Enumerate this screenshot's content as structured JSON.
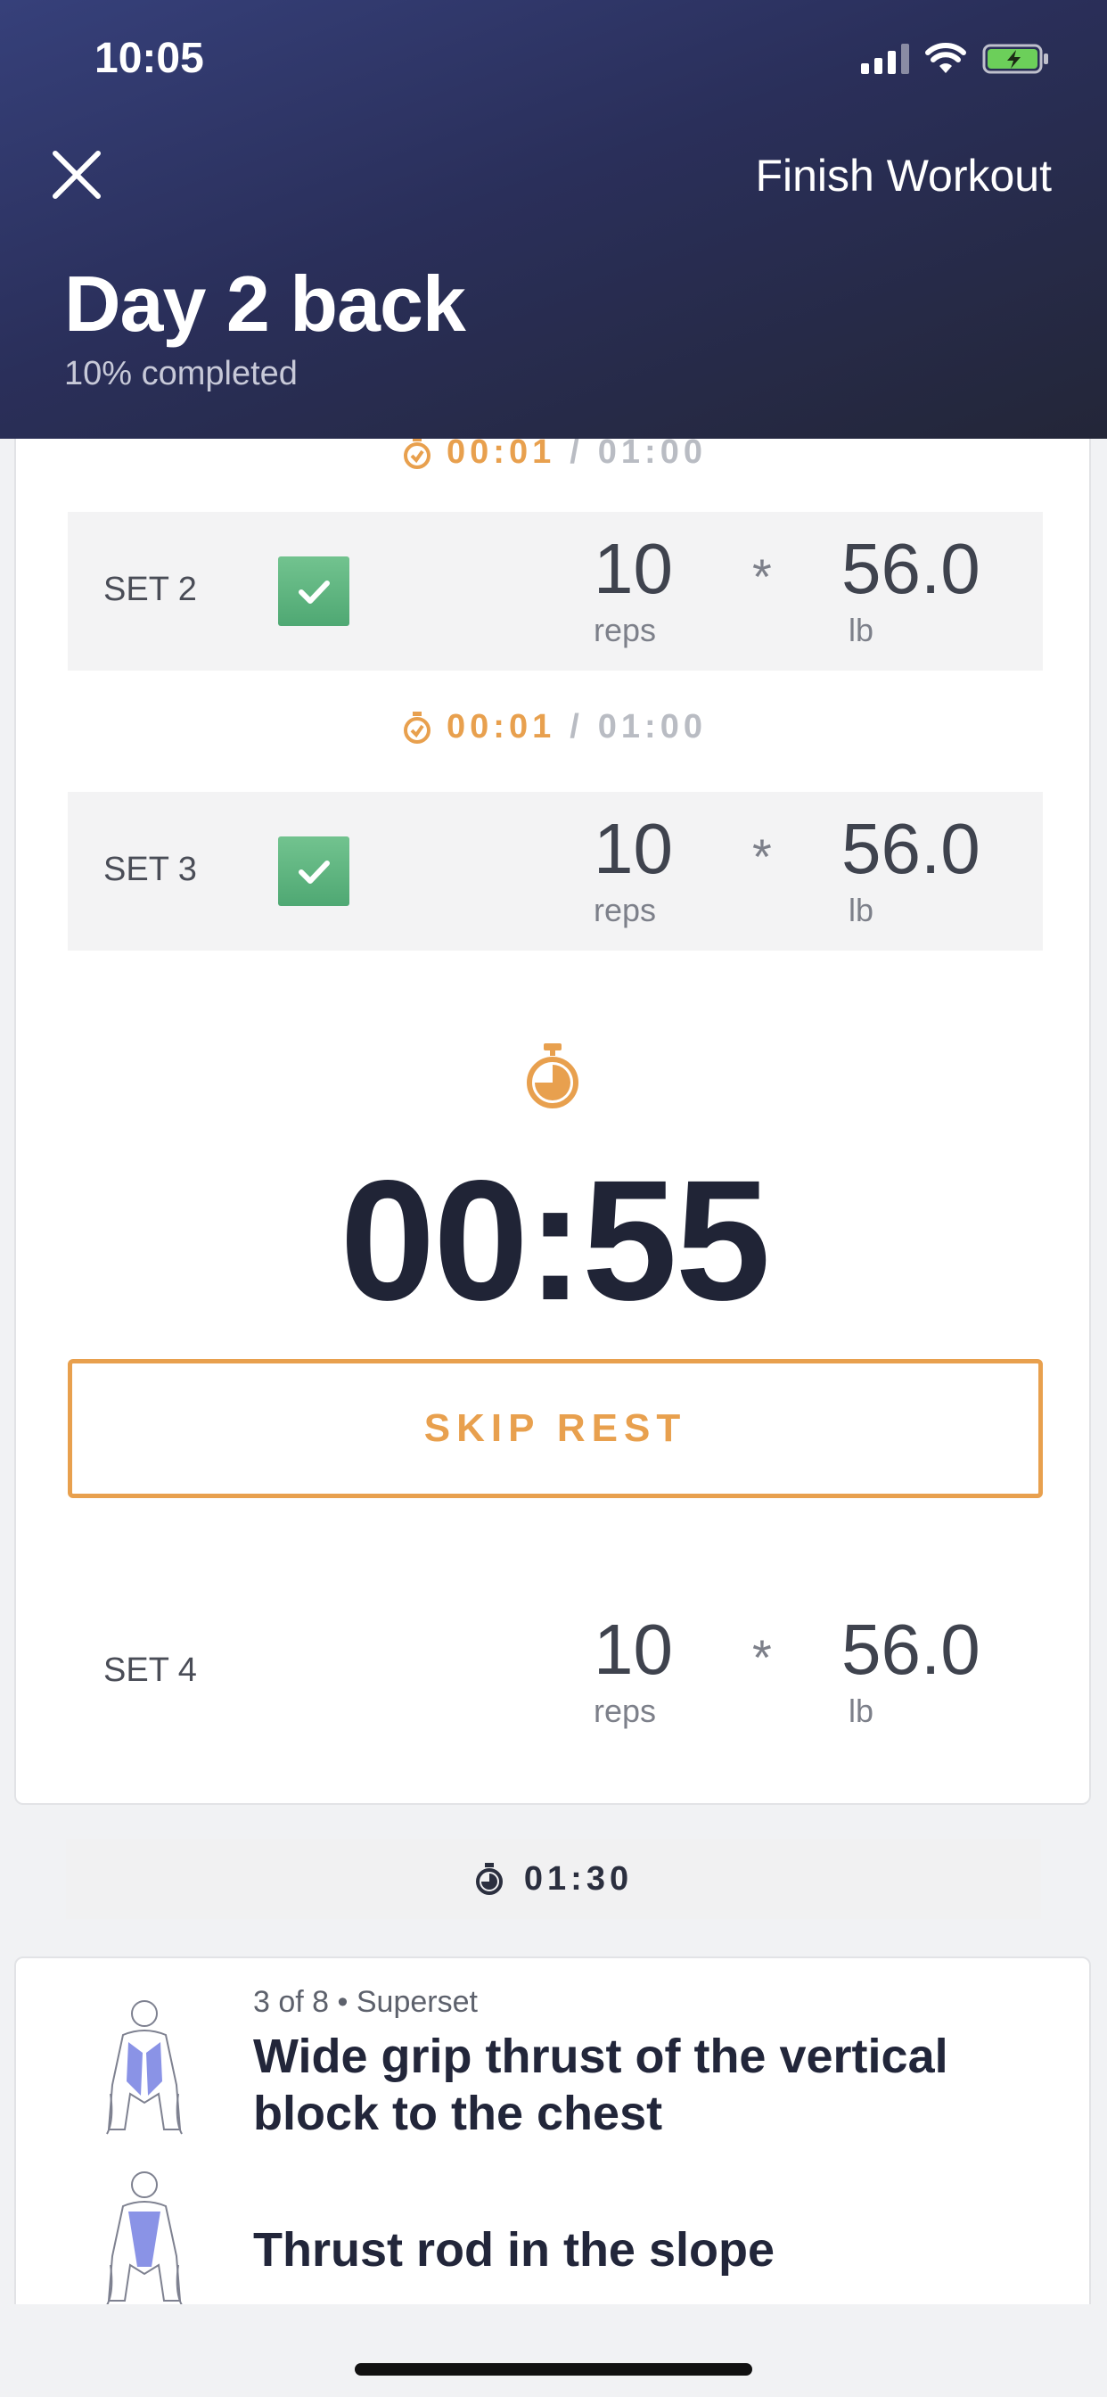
{
  "status_bar": {
    "time": "10:05"
  },
  "header": {
    "finish_label": "Finish Workout",
    "title": "Day 2 back",
    "subtitle": "10% completed"
  },
  "rest_between_sets": [
    {
      "elapsed": "00:01",
      "separator": "/",
      "total": "01:00"
    },
    {
      "elapsed": "00:01",
      "separator": "/",
      "total": "01:00"
    }
  ],
  "sets": [
    {
      "label": "SET 2",
      "completed": true,
      "reps": "10",
      "reps_unit": "reps",
      "times": "*",
      "weight": "56.0",
      "weight_unit": "lb"
    },
    {
      "label": "SET 3",
      "completed": true,
      "reps": "10",
      "reps_unit": "reps",
      "times": "*",
      "weight": "56.0",
      "weight_unit": "lb"
    },
    {
      "label": "SET 4",
      "completed": false,
      "reps": "10",
      "reps_unit": "reps",
      "times": "*",
      "weight": "56.0",
      "weight_unit": "lb"
    }
  ],
  "rest_timer": {
    "remaining": "00:55",
    "skip_label": "SKIP REST"
  },
  "rest_between_exercises": "01:30",
  "next_exercise": {
    "meta": "3 of 8 • Superset",
    "name_1": "Wide grip thrust of the vertical block to the chest",
    "name_2": "Thrust rod in the slope"
  },
  "colors": {
    "accent": "#e8a04e",
    "check": "#5cb57f",
    "header_bg": "#2a2f5a",
    "battery": "#6ccf5a"
  },
  "icons": [
    "close-icon",
    "signal-icon",
    "wifi-icon",
    "battery-icon",
    "stopwatch-icon",
    "check-icon",
    "muscle-figure-icon"
  ]
}
